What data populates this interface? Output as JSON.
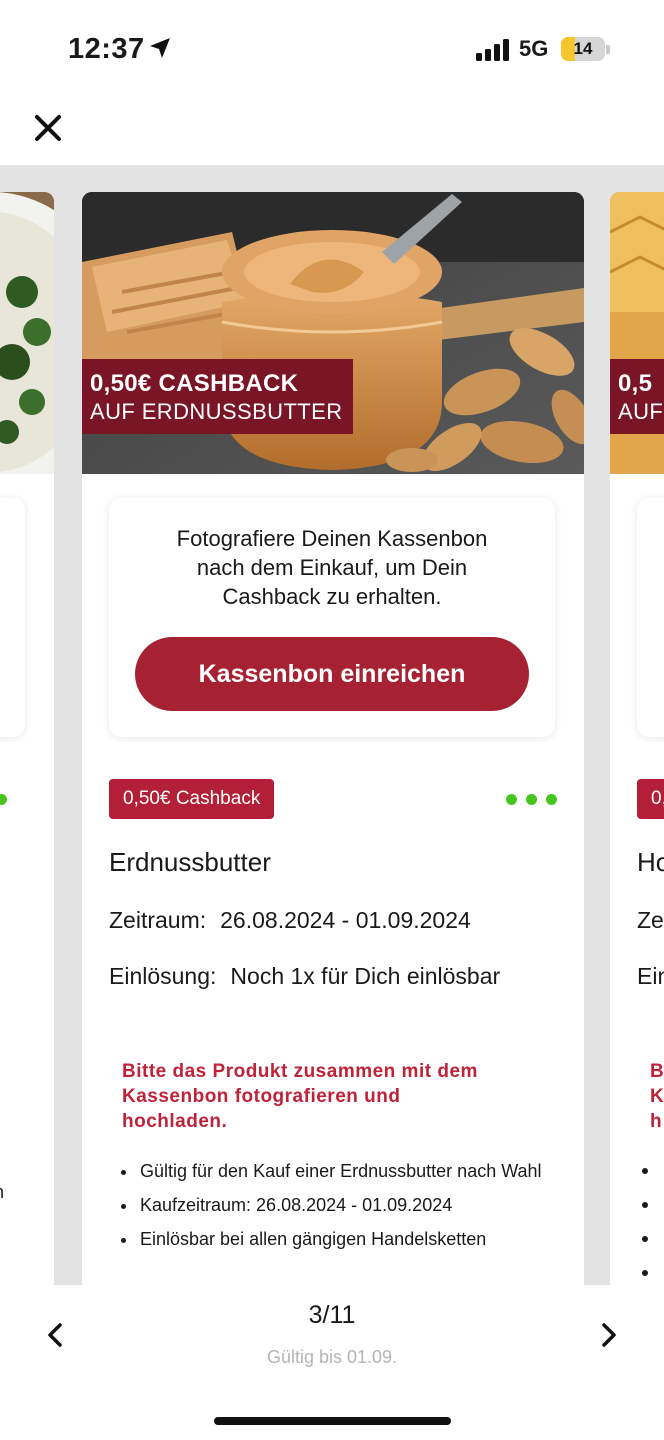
{
  "status_bar": {
    "time": "12:37",
    "network": "5G",
    "battery": "14",
    "battery_level": 0.14
  },
  "icons": {
    "close": "close-icon",
    "location": "location-arrow-icon",
    "signal": "signal-bars-icon",
    "battery": "battery-icon",
    "prev": "chevron-left-icon",
    "next": "chevron-right-icon",
    "more": "more-dots-icon"
  },
  "colors": {
    "brand_red": "#a62232",
    "badge_red": "#b21f36",
    "banner_red": "#7a1526",
    "notice_red": "#c0223a",
    "dots_green": "#46c61d",
    "carousel_bg": "#e3e3e3"
  },
  "card": {
    "promo_title": "0,50€ CASHBACK",
    "promo_subtitle": "AUF ERDNUSSBUTTER",
    "receipt_text_line1": "Fotografiere Deinen Kassenbon",
    "receipt_text_line2": "nach dem Einkauf, um Dein",
    "receipt_text_line3": "Cashback zu erhalten.",
    "submit_label": "Kassenbon einreichen",
    "cashback_badge": "0,50€ Cashback",
    "product_name": "Erdnussbutter",
    "period_label": "Zeitraum:",
    "period_value": "26.08.2024 - 01.09.2024",
    "redeem_label": "Einlösung:",
    "redeem_value": "Noch 1x für Dich einlösbar",
    "notice_line1": "Bitte das Produkt zusammen mit dem",
    "notice_line2": "Kassenbon fotografieren und",
    "notice_line3": "hochladen.",
    "conditions": [
      "Gültig für den Kauf einer Erdnussbutter nach Wahl",
      "Kaufzeitraum: 26.08.2024 - 01.09.2024",
      "Einlösbar bei allen gängigen Handelsketten"
    ]
  },
  "right_card_peek": {
    "promo_title": "0,5",
    "promo_subtitle": "AUF",
    "badge": "0,",
    "product_name": "Ho",
    "period_label": "Ze",
    "redeem_label": "Ein",
    "notice_line1": "B",
    "notice_line2": "K",
    "notice_line3": "h"
  },
  "left_card_peek": {
    "text_fragment": "n"
  },
  "pagination": {
    "counter": "3/11",
    "valid_until": "Gültig bis 01.09."
  }
}
